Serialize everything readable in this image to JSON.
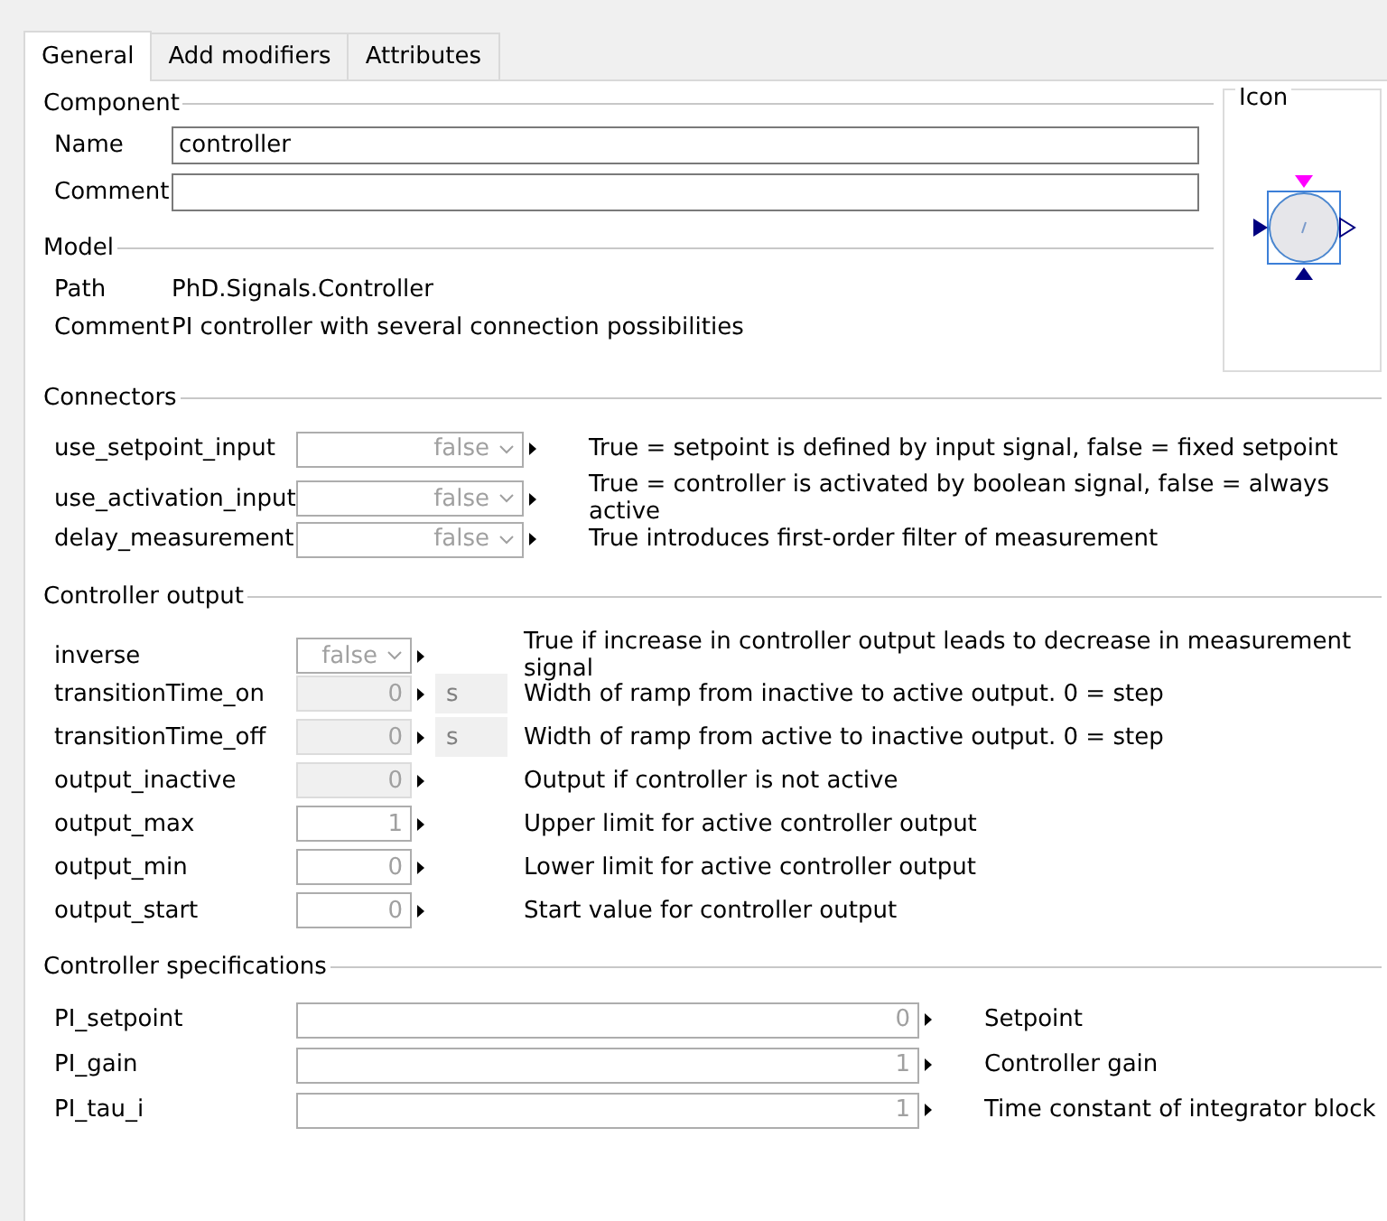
{
  "tabs": [
    {
      "label": "General",
      "selected": true
    },
    {
      "label": "Add modifiers",
      "selected": false
    },
    {
      "label": "Attributes",
      "selected": false
    }
  ],
  "component": {
    "title": "Component",
    "fields": [
      {
        "label": "Name",
        "value": "controller"
      },
      {
        "label": "Comment"
      }
    ]
  },
  "model": {
    "title": "Model",
    "rows": [
      {
        "label": "Path",
        "value": "PhD.Signals.Controller"
      },
      {
        "label": "Comment",
        "value": "PI controller with several connection possibilities"
      }
    ]
  },
  "icon_panel": {
    "title": "Icon"
  },
  "sections": [
    {
      "title": "Connectors",
      "rows": [
        {
          "name": "use_setpoint_input",
          "kind": "dropdown",
          "value": "false",
          "disabled": false,
          "description": "True = setpoint is defined by input signal, false = fixed setpoint"
        },
        {
          "name": "use_activation_input",
          "kind": "dropdown",
          "value": "false",
          "disabled": false,
          "description": "True = controller is activated by boolean signal, false = always active"
        },
        {
          "name": "delay_measurement",
          "kind": "dropdown",
          "value": "false",
          "disabled": false,
          "description": "True introduces first-order filter of measurement"
        }
      ]
    },
    {
      "title": "Controller output",
      "rows": [
        {
          "name": "inverse",
          "kind": "dropdown",
          "value": "false",
          "disabled": false,
          "description": "True if increase in controller output leads to decrease in measurement signal"
        },
        {
          "name": "transitionTime_on",
          "kind": "number",
          "value": "0",
          "disabled": true,
          "unit": "s",
          "description": "Width of ramp from inactive to active output. 0 = step"
        },
        {
          "name": "transitionTime_off",
          "kind": "number",
          "value": "0",
          "disabled": true,
          "unit": "s",
          "description": "Width of ramp from active to inactive output. 0 = step"
        },
        {
          "name": "output_inactive",
          "kind": "number",
          "value": "0",
          "disabled": true,
          "description": "Output if controller is not active"
        },
        {
          "name": "output_max",
          "kind": "number",
          "value": "1",
          "disabled": false,
          "description": "Upper limit for active controller output"
        },
        {
          "name": "output_min",
          "kind": "number",
          "value": "0",
          "disabled": false,
          "description": "Lower limit for active controller output"
        },
        {
          "name": "output_start",
          "kind": "number",
          "value": "0",
          "disabled": false,
          "description": "Start value for controller output"
        }
      ]
    },
    {
      "title": "Controller specifications",
      "rows": [
        {
          "name": "PI_setpoint",
          "kind": "number",
          "value": "0",
          "disabled": false,
          "description": "Setpoint"
        },
        {
          "name": "PI_gain",
          "kind": "number",
          "value": "1",
          "disabled": false,
          "description": "Controller gain"
        },
        {
          "name": "PI_tau_i",
          "kind": "number",
          "value": "1",
          "disabled": false,
          "description": "Time constant of integrator block"
        }
      ]
    }
  ]
}
